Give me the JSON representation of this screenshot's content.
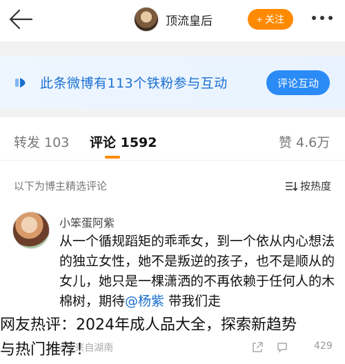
{
  "header": {
    "profile_name": "顶流皇后",
    "follow_label": "+ 关注"
  },
  "banner": {
    "text": "此条微博有113个铁粉参与互动",
    "button_label": "评论互动"
  },
  "tabs": {
    "repost": "转发 103",
    "comments": "评论 1592",
    "likes": "赞 4.6万"
  },
  "section": {
    "label": "以下为博主精选评论",
    "sort_label": "按热度"
  },
  "comment": {
    "author": "小笨蛋阿紫",
    "body_prefix": "从一个循规蹈矩的乖乖女，到一个依从内心想法的独立女性，她不是叛逆的孩子，也不是顺从的女儿，她只是一棵潇洒的不再依赖于任何人的木棉树，期待",
    "mention": "@杨紫",
    "body_suffix": " 带我们走",
    "meta": "45 来自湖南",
    "likes": "429"
  },
  "overlay": {
    "line1": "网友热评：2024年成人品大全，探索新趋势",
    "line2": "与热门推荐！"
  },
  "colors": {
    "accent_orange": "#ff8a00",
    "link_blue": "#1a6fd1",
    "button_blue": "#2a8af6"
  }
}
